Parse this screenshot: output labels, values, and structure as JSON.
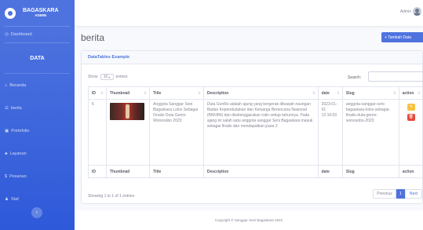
{
  "brand": {
    "name": "BAGASKARA",
    "sub": "ADMIN"
  },
  "sidebar": {
    "dashboard": {
      "icon": "dashboard-icon",
      "label": "Dashboard"
    },
    "heading": "DATA",
    "items": [
      {
        "icon": "home-icon",
        "label": "Beranda"
      },
      {
        "icon": "list-icon",
        "label": "berita"
      },
      {
        "icon": "image-icon",
        "label": "Portofolio"
      },
      {
        "icon": "service-icon",
        "label": "Layanan"
      },
      {
        "icon": "dollar-icon",
        "label": "Pesanan"
      },
      {
        "icon": "users-icon",
        "label": "Staf"
      }
    ],
    "toggler_icon": "chevron-left-icon"
  },
  "topbar": {
    "user": "Admin"
  },
  "page": {
    "title": "berita",
    "add_button": "+ Tambah Data"
  },
  "card": {
    "title": "DataTables Example"
  },
  "datatable": {
    "show_prefix": "Show",
    "length": "10",
    "show_suffix": "entries",
    "search_label": "Search:",
    "columns": [
      "ID",
      "Thumbnail",
      "Title",
      "Description",
      "date",
      "Slug",
      "action"
    ],
    "rows": [
      {
        "id": "6",
        "title": "Anggota Sanggar Seni Bagaskara Lolos Sebagai Finalis Duta Genre Wonosobo 2023",
        "description": "Duta GenRe adalah ajang yang bergerak dibawah naungan Badan Kependudukan dan Keluarga Berencana Nasional (BKKBN) dan diselenggarakan rutin setiap tahunnya. Pada ajang ini salah satu anggota sanggar Seni Bagaskara masuk sebagai finalis dan mendapatkan juara 2",
        "date": "2023-01-01 12:16:03",
        "slug": "anggota-sanggar-seni-bagaskara-lolos-sebagai-finalis-duta-genre-wonosobo-2023"
      }
    ],
    "info": "Showing 1 to 1 of 1 entries",
    "pagination": {
      "previous": "Previous",
      "current": "1",
      "next": "Next"
    }
  },
  "footer": {
    "text": "Copyright © Sanggar Seni Bagaskara 2022"
  },
  "colors": {
    "primary": "#4e73df",
    "warning": "#f6c23e",
    "danger": "#e74a3b"
  }
}
